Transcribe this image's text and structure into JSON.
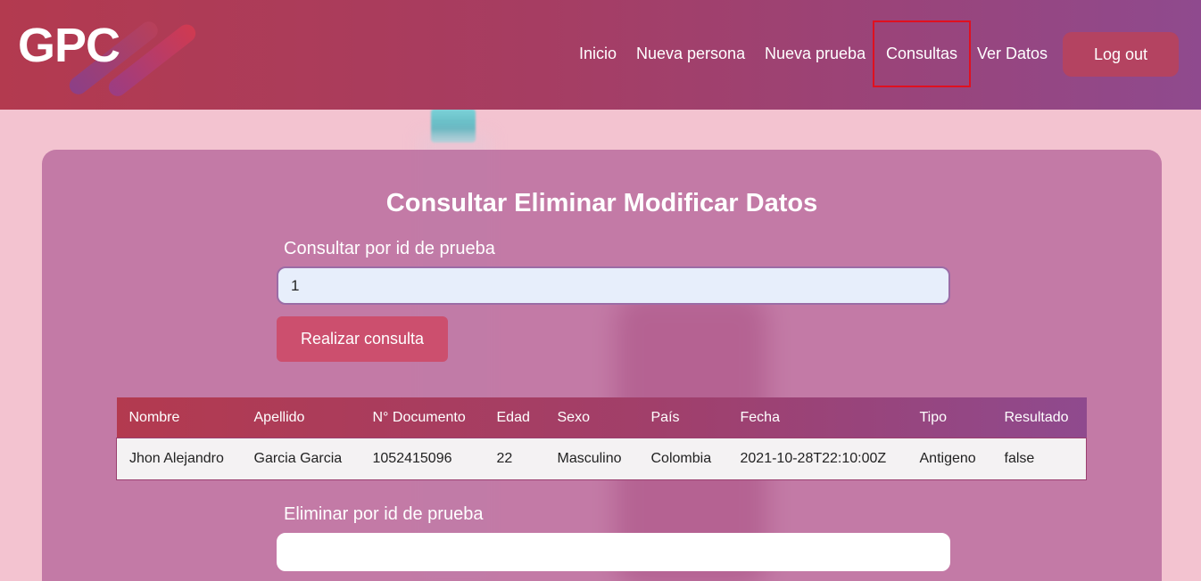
{
  "logo": {
    "text": "GPC"
  },
  "nav": {
    "items": [
      {
        "label": "Inicio"
      },
      {
        "label": "Nueva persona"
      },
      {
        "label": "Nueva prueba"
      },
      {
        "label": "Consultas"
      },
      {
        "label": "Ver Datos"
      }
    ],
    "active": "Consultas",
    "logout_label": "Log out"
  },
  "main": {
    "title": "Consultar Eliminar Modificar Datos",
    "consultar": {
      "label": "Consultar por id de prueba",
      "value": "1",
      "button_label": "Realizar consulta"
    },
    "eliminar": {
      "label": "Eliminar por id de prueba",
      "value": ""
    }
  },
  "table": {
    "headers": [
      "Nombre",
      "Apellido",
      "N° Documento",
      "Edad",
      "Sexo",
      "País",
      "Fecha",
      "Tipo",
      "Resultado"
    ],
    "rows": [
      [
        "Jhon Alejandro",
        "Garcia Garcia",
        "1052415096",
        "22",
        "Masculino",
        "Colombia",
        "2021-10-28T22:10:00Z",
        "Antigeno",
        "false"
      ]
    ]
  },
  "colors": {
    "header_start": "#b33a4f",
    "header_end": "#8f4a8e",
    "button": "#cc4f6e",
    "active_outline": "#e01020"
  }
}
